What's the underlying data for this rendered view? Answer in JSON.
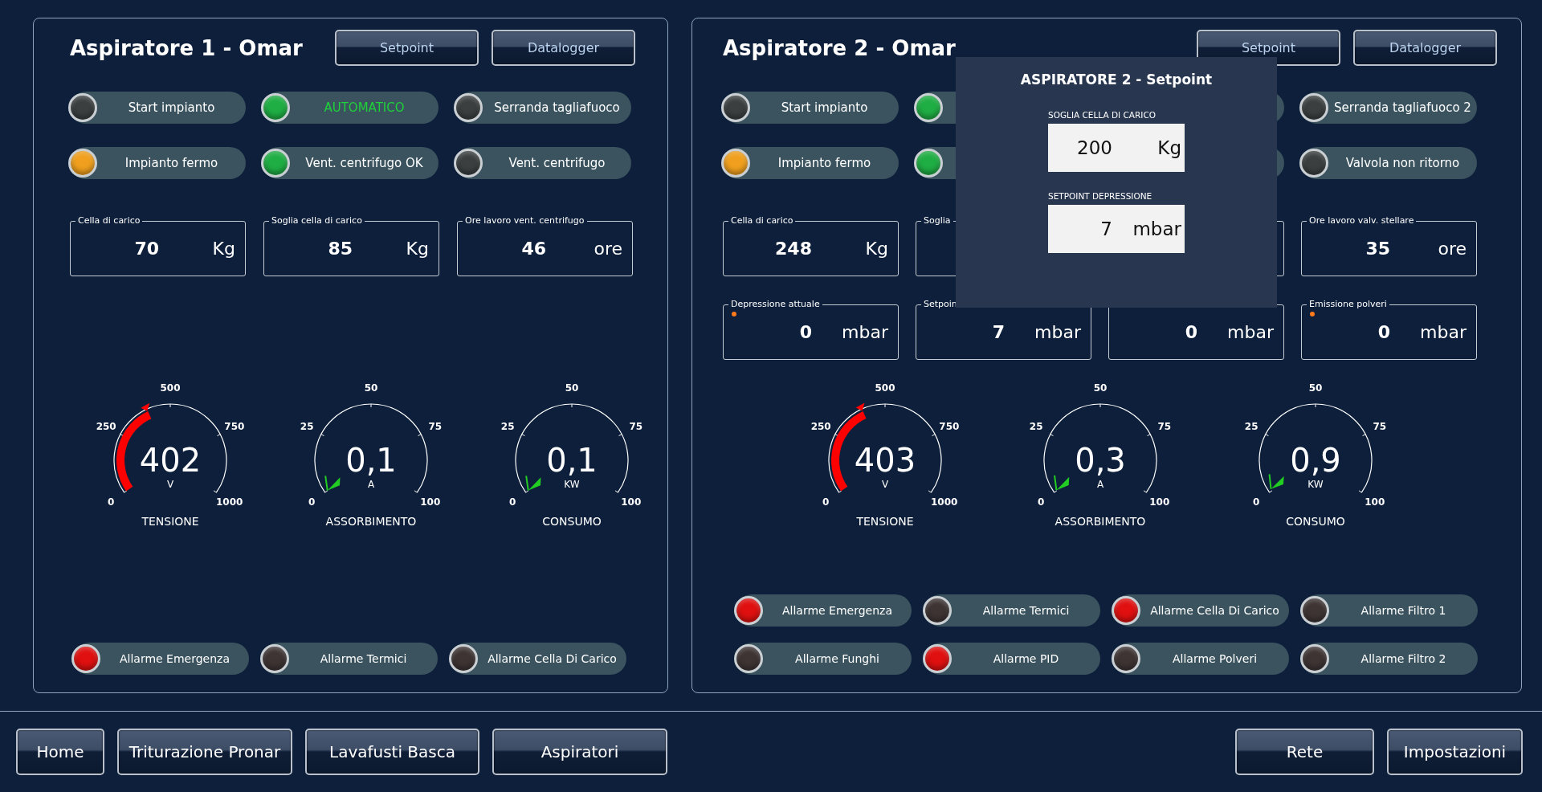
{
  "panels": [
    {
      "title": "Aspiratore 1 - Omar",
      "buttons": [
        "Setpoint",
        "Datalogger"
      ],
      "indicators": [
        {
          "label": "Start impianto",
          "color": "#3b3f3f",
          "highlighted": false
        },
        {
          "label": "AUTOMATICO",
          "color": "#1fae44",
          "highlighted": true
        },
        {
          "label": "Serranda tagliafuoco",
          "color": "#3b3f3f",
          "highlighted": false
        },
        {
          "label": "Impianto fermo",
          "color": "#f0a01e",
          "highlighted": false
        },
        {
          "label": "Vent. centrifugo OK",
          "color": "#1fae44",
          "highlighted": false
        },
        {
          "label": "Vent. centrifugo",
          "color": "#3b3f3f",
          "highlighted": false
        }
      ],
      "fields": [
        {
          "label": "Cella di carico",
          "value": "70",
          "unit": "Kg",
          "dot": false
        },
        {
          "label": "Soglia cella di carico",
          "value": "85",
          "unit": "Kg",
          "dot": false
        },
        {
          "label": "Ore lavoro vent. centrifugo",
          "value": "46",
          "unit": "ore",
          "dot": false
        }
      ],
      "gauges": [
        {
          "kind": "band",
          "value": "402",
          "unit": "V",
          "title": "TENSIONE",
          "ticks": [
            "500",
            "250",
            "750",
            "0",
            "1000"
          ]
        },
        {
          "kind": "needle",
          "value": "0,1",
          "unit": "A",
          "title": "ASSORBIMENTO",
          "ticks": [
            "50",
            "25",
            "75",
            "0",
            "100"
          ]
        },
        {
          "kind": "needle",
          "value": "0,1",
          "unit": "KW",
          "title": "CONSUMO",
          "ticks": [
            "50",
            "25",
            "75",
            "0",
            "100"
          ]
        }
      ],
      "alarms": [
        {
          "label": "Allarme Emergenza",
          "color": "#e01010"
        },
        {
          "label": "Allarme Termici",
          "color": "#3e3434"
        },
        {
          "label": "Allarme Cella Di Carico",
          "color": "#3e3434"
        }
      ]
    },
    {
      "title": "Aspiratore 2 - Omar",
      "buttons": [
        "Setpoint",
        "Datalogger"
      ],
      "indicators": [
        {
          "label": "Start impianto",
          "color": "#3b3f3f",
          "highlighted": false
        },
        {
          "color": "#1fae44"
        },
        {
          "label": "Serranda tagliafuoco 2",
          "color": "#3b3f3f",
          "highlighted": false
        },
        {
          "label": "Impianto fermo",
          "color": "#f0a01e",
          "highlighted": false
        },
        {
          "color": "#1fae44"
        },
        {
          "label": "Valvola non ritorno",
          "color": "#3b3f3f",
          "highlighted": false
        }
      ],
      "fields": [
        {
          "label": "Cella di carico",
          "value": "248",
          "unit": "Kg",
          "dot": false
        },
        {
          "label": "Soglia",
          "dot": false
        },
        {
          "label": "Ore lavoro valv. stellare",
          "value": "35",
          "unit": "ore",
          "dot": false
        },
        {
          "label": "Depressione attuale",
          "value": "0",
          "unit": "mbar",
          "dot": true
        },
        {
          "label": "Setpoin",
          "value": "7",
          "unit": "mbar",
          "dot": false
        },
        {
          "value": "0",
          "unit": "mbar",
          "dot": false
        },
        {
          "label": "Emissione polveri",
          "value": "0",
          "unit": "mbar",
          "dot": true
        }
      ],
      "gauges": [
        {
          "kind": "band",
          "value": "403",
          "unit": "V",
          "title": "TENSIONE",
          "ticks": [
            "500",
            "250",
            "750",
            "0",
            "1000"
          ]
        },
        {
          "kind": "needle",
          "value": "0,3",
          "unit": "A",
          "title": "ASSORBIMENTO",
          "ticks": [
            "50",
            "25",
            "75",
            "0",
            "100"
          ]
        },
        {
          "kind": "needle",
          "value": "0,9",
          "unit": "KW",
          "title": "CONSUMO",
          "ticks": [
            "50",
            "25",
            "75",
            "0",
            "100"
          ]
        }
      ],
      "alarms": [
        {
          "label": "Allarme Emergenza",
          "color": "#e01010"
        },
        {
          "label": "Allarme Termici",
          "color": "#3e3434"
        },
        {
          "label": "Allarme Cella Di Carico",
          "color": "#e01010"
        },
        {
          "label": "Allarme Filtro 1",
          "color": "#3e3434"
        },
        {
          "label": "Allarme Funghi",
          "color": "#3e3434"
        },
        {
          "label": "Allarme PID",
          "color": "#e01010"
        },
        {
          "label": "Allarme Polveri",
          "color": "#3e3434"
        },
        {
          "label": "Allarme Filtro 2",
          "color": "#3e3434"
        }
      ],
      "popup": {
        "title": "ASPIRATORE 2 - Setpoint",
        "fields": [
          {
            "label": "SOGLIA CELLA DI CARICO",
            "value": "200",
            "unit": "Kg"
          },
          {
            "label": "SETPOINT DEPRESSIONE",
            "value": "7",
            "unit": "mbar"
          }
        ]
      }
    }
  ],
  "nav": {
    "left": [
      "Home",
      "Triturazione Pronar",
      "Lavafusti Basca",
      "Aspiratori"
    ],
    "right": [
      "Rete",
      "Impostazioni"
    ]
  }
}
